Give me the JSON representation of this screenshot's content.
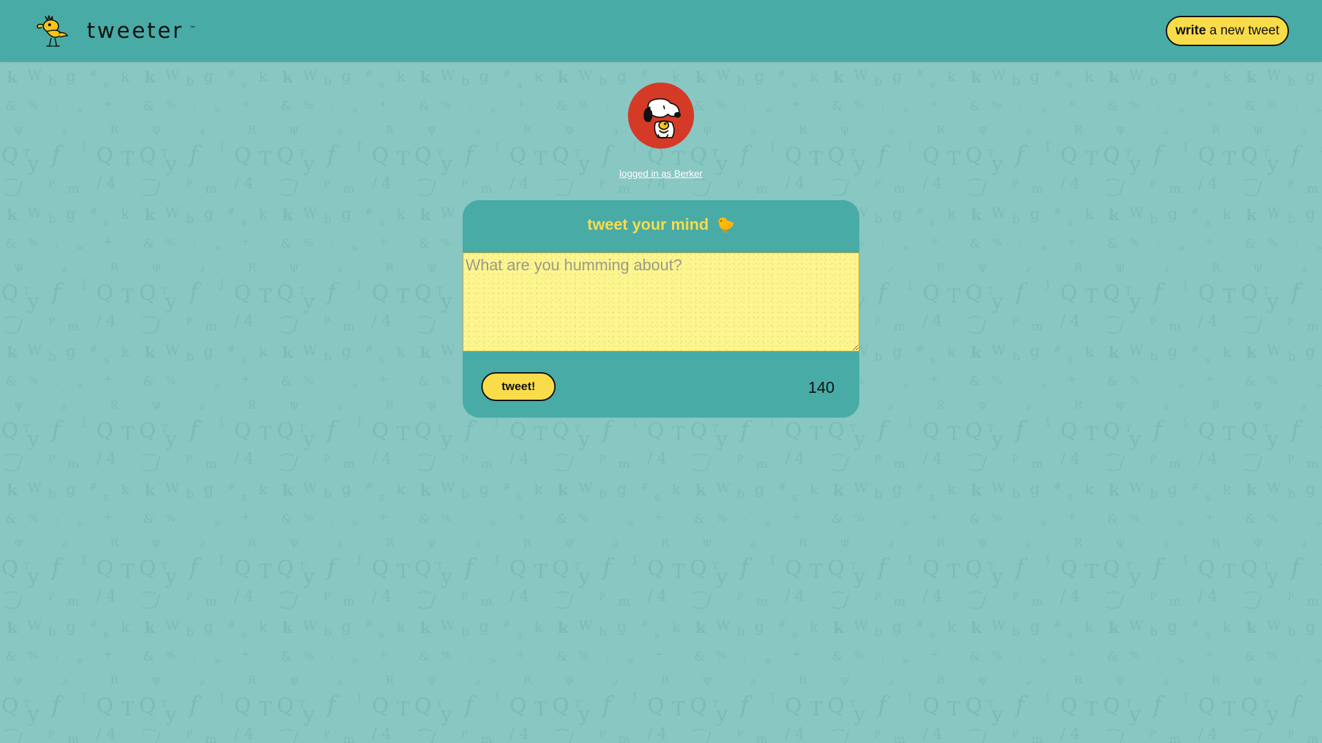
{
  "nav": {
    "brand_name": "tweeter",
    "brand_tm": "™",
    "write_button_strong": "write",
    "write_button_rest": "a new tweet"
  },
  "profile": {
    "login_text": "logged in as Berker"
  },
  "composer": {
    "title": "tweet your mind",
    "title_icon": "🐤",
    "placeholder": "What are you humming about?",
    "submit_label": "tweet!",
    "char_counter": "140"
  },
  "icons": {
    "brand_logo": "woodstock-bird-icon",
    "avatar": "snoopy-avatar"
  },
  "colors": {
    "background": "#88c7c2",
    "nav": "#48aba6",
    "accent_yellow": "#f9dc4a",
    "avatar_red": "#d53a26",
    "compose_bg": "#fdf68f"
  }
}
